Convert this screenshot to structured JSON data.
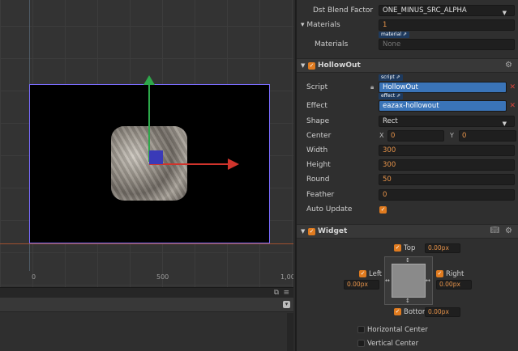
{
  "scene": {
    "ruler_labels": [
      "0",
      "500",
      "1,00"
    ]
  },
  "inspector": {
    "dst_blend": {
      "label": "Dst Blend Factor",
      "value": "ONE_MINUS_SRC_ALPHA"
    },
    "materials_header": {
      "label": "Materials",
      "value": "1"
    },
    "materials_item": {
      "label": "Materials",
      "tag": "material",
      "value": "None"
    },
    "hollowout": {
      "title": "HollowOut",
      "script": {
        "label": "Script",
        "tag": "script",
        "value": "HollowOut"
      },
      "effect": {
        "label": "Effect",
        "tag": "effect",
        "value": "eazax-hollowout"
      },
      "shape": {
        "label": "Shape",
        "value": "Rect"
      },
      "center": {
        "label": "Center",
        "x_axis": "X",
        "x": "0",
        "y_axis": "Y",
        "y": "0"
      },
      "width": {
        "label": "Width",
        "value": "300"
      },
      "height": {
        "label": "Height",
        "value": "300"
      },
      "round": {
        "label": "Round",
        "value": "50"
      },
      "feather": {
        "label": "Feather",
        "value": "0"
      },
      "auto_update": {
        "label": "Auto Update",
        "checked": true
      }
    },
    "widget": {
      "title": "Widget",
      "top": {
        "label": "Top",
        "value": "0.00px"
      },
      "left": {
        "label": "Left",
        "value": "0.00px"
      },
      "right": {
        "label": "Right",
        "value": "0.00px"
      },
      "bottom": {
        "label": "Bottom",
        "value": "0.00px"
      },
      "horizontal_center": "Horizontal Center",
      "vertical_center": "Vertical Center"
    }
  },
  "colors": {
    "accent": "#e07b1f",
    "selected_field": "#3a74b8",
    "gizmo_x": "#d0342c",
    "gizmo_y": "#2da84a",
    "canvas_border": "#7a6cff"
  }
}
